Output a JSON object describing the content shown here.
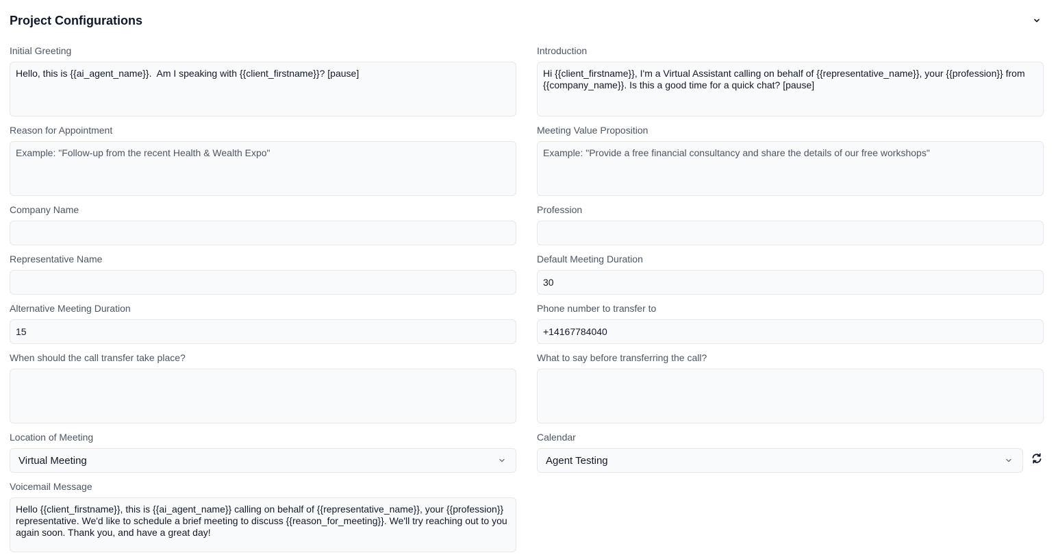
{
  "header": {
    "title": "Project Configurations"
  },
  "fields": {
    "initial_greeting": {
      "label": "Initial Greeting",
      "value": "Hello, this is {{ai_agent_name}}.  Am I speaking with {{client_firstname}}? [pause]"
    },
    "introduction": {
      "label": "Introduction",
      "value": "Hi {{client_firstname}}, I'm a Virtual Assistant calling on behalf of {{representative_name}}, your {{profession}} from {{company_name}}. Is this a good time for a quick chat? [pause]"
    },
    "reason_for_appointment": {
      "label": "Reason for Appointment",
      "placeholder": "Example: \"Follow-up from the recent Health & Wealth Expo\""
    },
    "meeting_value_proposition": {
      "label": "Meeting Value Proposition",
      "placeholder": "Example: \"Provide a free financial consultancy and share the details of our free workshops\""
    },
    "company_name": {
      "label": "Company Name",
      "value": ""
    },
    "profession": {
      "label": "Profession",
      "value": ""
    },
    "representative_name": {
      "label": "Representative Name",
      "value": ""
    },
    "default_meeting_duration": {
      "label": "Default Meeting Duration",
      "value": "30"
    },
    "alternative_meeting_duration": {
      "label": "Alternative Meeting Duration",
      "value": "15"
    },
    "phone_transfer": {
      "label": "Phone number to transfer to",
      "value": "+14167784040"
    },
    "transfer_when": {
      "label": "When should the call transfer take place?",
      "value": ""
    },
    "transfer_say": {
      "label": "What to say before transferring the call?",
      "value": ""
    },
    "location": {
      "label": "Location of Meeting",
      "selected": "Virtual Meeting"
    },
    "calendar": {
      "label": "Calendar",
      "selected": "Agent Testing"
    },
    "voicemail": {
      "label": "Voicemail Message",
      "value": "Hello {{client_firstname}}, this is {{ai_agent_name}} calling on behalf of {{representative_name}}, your {{profession}} representative. We'd like to schedule a brief meeting to discuss {{reason_for_meeting}}. We'll try reaching out to you again soon. Thank you, and have a great day!"
    }
  },
  "icons": {
    "collapse": "chevron-down-icon",
    "select_caret": "chevron-down-icon",
    "refresh": "refresh-icon"
  },
  "colors": {
    "field_bg": "#f9fafb",
    "field_border": "#e5e7eb",
    "label": "#4b5563",
    "text": "#111827"
  }
}
